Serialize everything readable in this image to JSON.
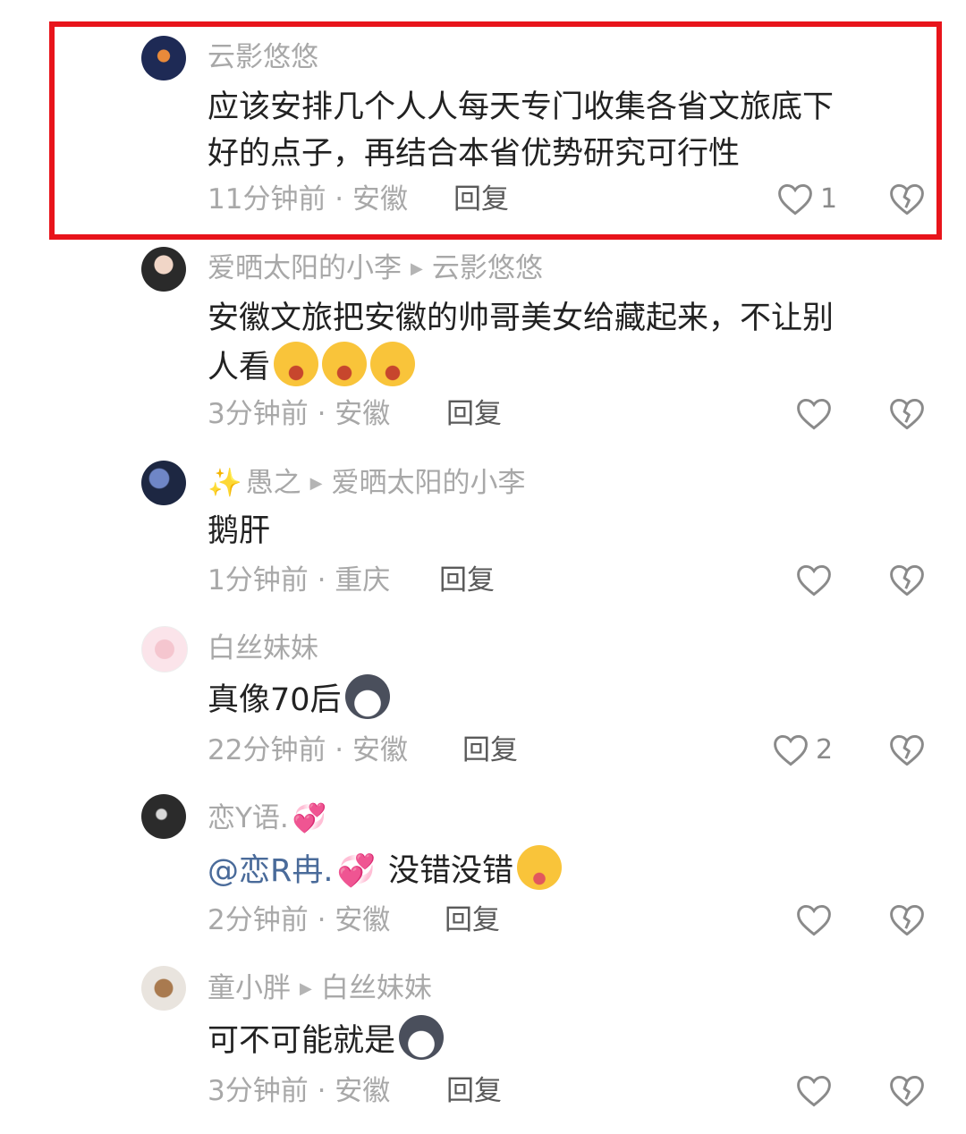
{
  "comments": [
    {
      "username": "云影悠悠",
      "lines": [
        "应该安排几个人人每天专门收集各省文旅底下",
        "好的点子，再结合本省优势研究可行性"
      ],
      "time": "11分钟前 · 安徽",
      "reply": "回复",
      "likes": "1"
    },
    {
      "username": "爱晒太阳的小李",
      "reply_to": "云影悠悠",
      "lines": [
        "安徽文旅把安徽的帅哥美女给藏起来，不让别",
        "人看"
      ],
      "emojis": [
        "laugh-cry-emoji",
        "laugh-cry-emoji",
        "laugh-cry-emoji"
      ],
      "time": "3分钟前 · 安徽",
      "reply": "回复"
    },
    {
      "username": "愚之",
      "reply_to": "爱晒太阳的小李",
      "lines": [
        "鹅肝"
      ],
      "time": "1分钟前 · 重庆",
      "reply": "回复"
    },
    {
      "username": "白丝妹妹",
      "lines": [
        "真像70后"
      ],
      "emojis": [
        "husky-dog-emoji"
      ],
      "time": "22分钟前 · 安徽",
      "reply": "回复",
      "likes": "2"
    },
    {
      "username": "恋Y语.",
      "mention": "@恋R冉.",
      "lines": [
        "没错没错"
      ],
      "emojis": [
        "wink-tongue-emoji"
      ],
      "time": "2分钟前 · 安徽",
      "reply": "回复"
    },
    {
      "username": "童小胖",
      "reply_to": "白丝妹妹",
      "lines": [
        "可不可能就是"
      ],
      "emojis": [
        "husky-dog-emoji"
      ],
      "time": "3分钟前 · 安徽",
      "reply": "回复"
    }
  ],
  "colors": {
    "highlight_border": "#e8141b",
    "mention": "#4a6b9a",
    "secondary_text": "#a8a8a8"
  }
}
